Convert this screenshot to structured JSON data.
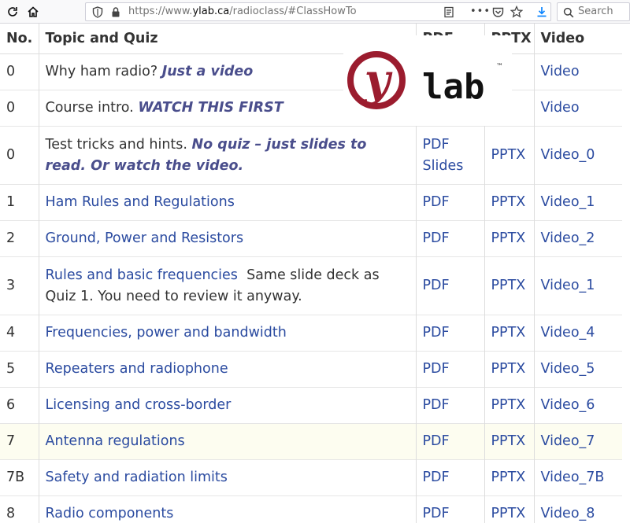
{
  "browser": {
    "url_prefix": "https://www.",
    "url_domain": "ylab.ca",
    "url_path": "/radioclass/#ClassHowTo",
    "search_placeholder": "Search"
  },
  "logo": {
    "letter": "y",
    "word": "lab",
    "mark": "™",
    "color": "#9b1c2e"
  },
  "table": {
    "headers": {
      "no": "No.",
      "topic": "Topic and Quiz",
      "pdf": "PDF",
      "pptx": "PPTX",
      "video": "Video"
    },
    "rows": [
      {
        "no": "0",
        "topic": "Why ham radio?",
        "note": "Just a video",
        "pdf": "",
        "pptx": "",
        "video": "Video"
      },
      {
        "no": "0",
        "topic": "Course intro.",
        "note": "WATCH THIS FIRST",
        "pdf": "",
        "pptx": "",
        "video": "Video"
      },
      {
        "no": "0",
        "topic": "Test tricks and hints.",
        "note": "No quiz – just slides to read. Or watch the video.",
        "pdf": "PDF",
        "pdf2": "Slides",
        "pptx": "PPTX",
        "video": "Video_0"
      },
      {
        "no": "1",
        "topic": "Ham Rules and Regulations",
        "pdf": "PDF",
        "pptx": "PPTX",
        "video": "Video_1"
      },
      {
        "no": "2",
        "topic": "Ground, Power and Resistors",
        "pdf": "PDF",
        "pptx": "PPTX",
        "video": "Video_2"
      },
      {
        "no": "3",
        "topic": "Rules and basic frequencies",
        "extra": "Same slide deck as Quiz 1. You need to review it anyway.",
        "pdf": "PDF",
        "pptx": "PPTX",
        "video": "Video_1"
      },
      {
        "no": "4",
        "topic": "Frequencies, power and bandwidth",
        "pdf": "PDF",
        "pptx": "PPTX",
        "video": "Video_4"
      },
      {
        "no": "5",
        "topic": "Repeaters and radiophone",
        "pdf": "PDF",
        "pptx": "PPTX",
        "video": "Video_5"
      },
      {
        "no": "6",
        "topic": "Licensing and cross-border",
        "pdf": "PDF",
        "pptx": "PPTX",
        "video": "Video_6"
      },
      {
        "no": "7",
        "topic": "Antenna regulations",
        "pdf": "PDF",
        "pptx": "PPTX",
        "video": "Video_7"
      },
      {
        "no": "7B",
        "topic": "Safety and radiation limits",
        "pdf": "PDF",
        "pptx": "PPTX",
        "video": "Video_7B"
      },
      {
        "no": "8",
        "topic": "Radio components",
        "pdf": "PDF",
        "pptx": "PPTX",
        "video": "Video_8"
      }
    ]
  }
}
